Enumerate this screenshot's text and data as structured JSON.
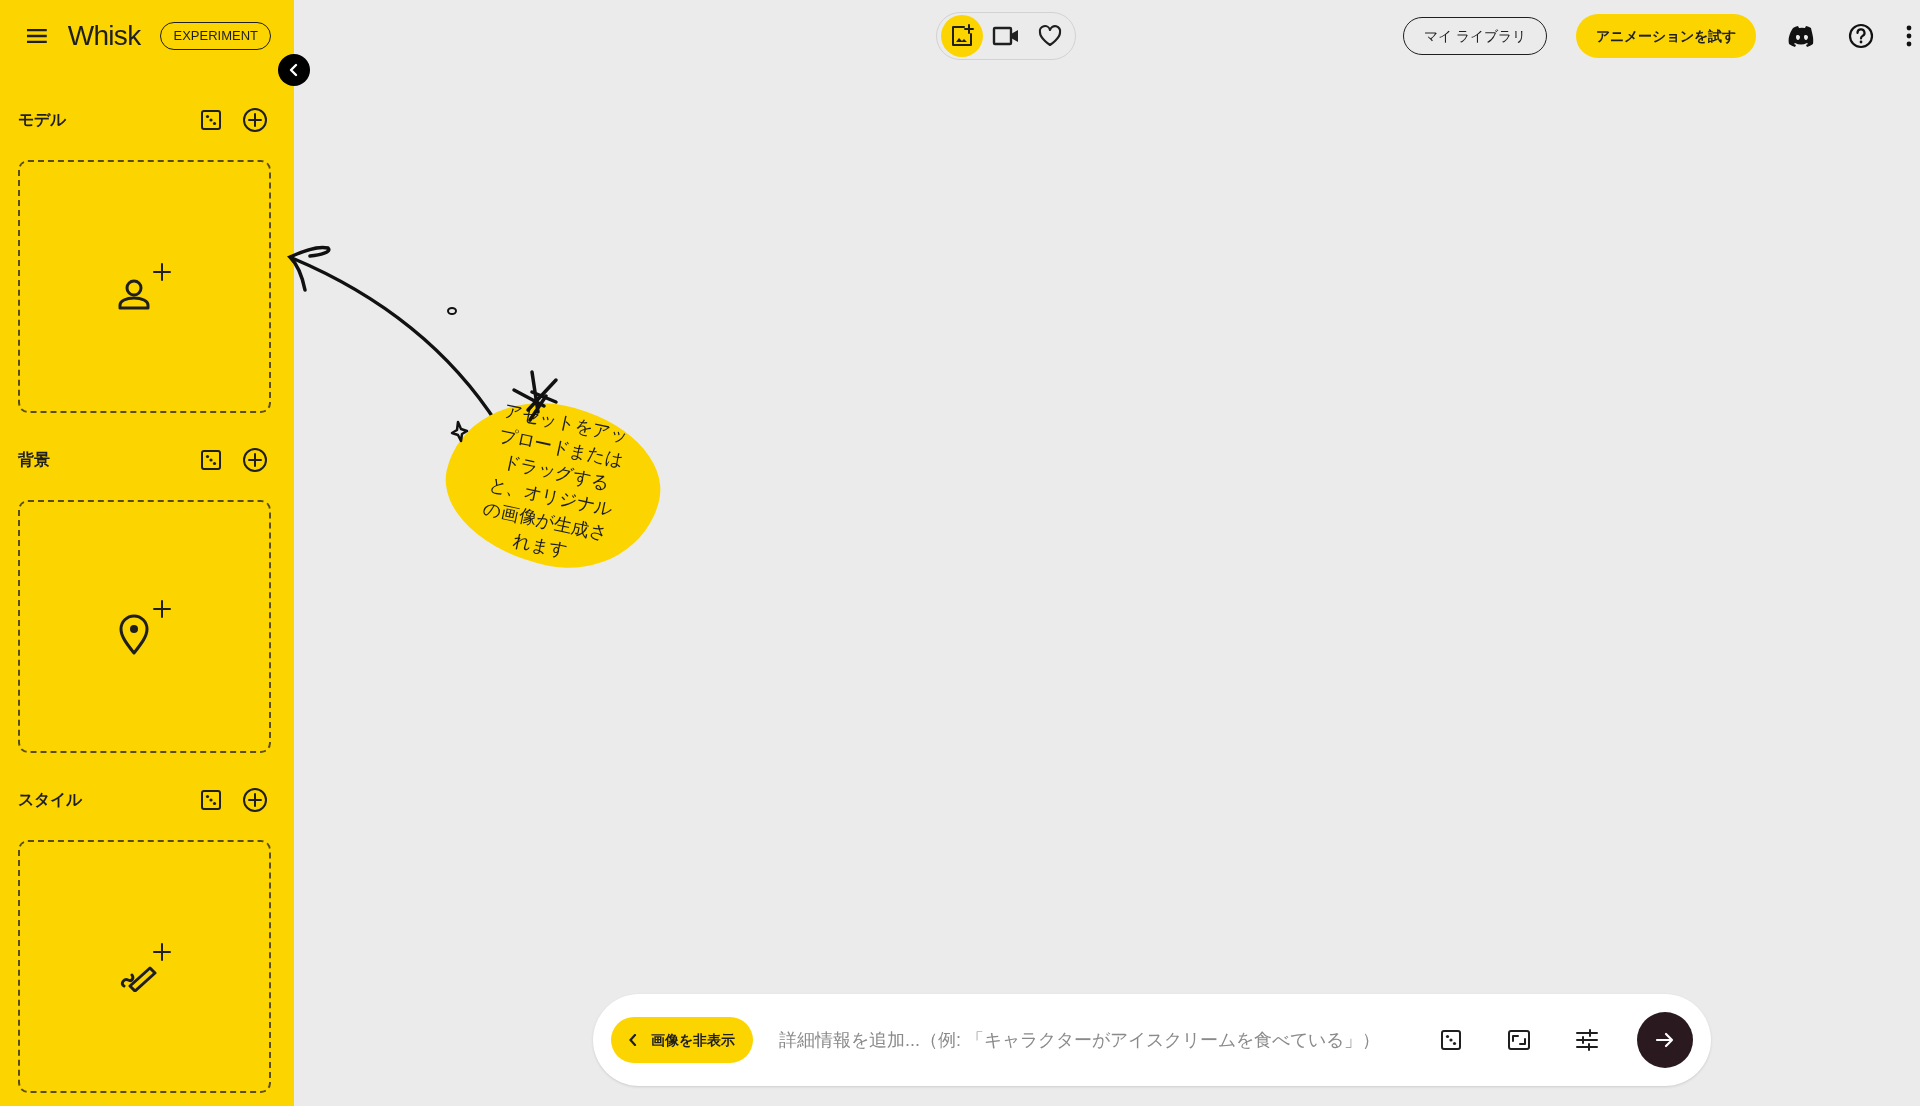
{
  "header": {
    "logo": "Whisk",
    "badge": "EXPERIMENT"
  },
  "sections": [
    {
      "title": "モデル",
      "kind": "subject"
    },
    {
      "title": "背景",
      "kind": "scene"
    },
    {
      "title": "スタイル",
      "kind": "style"
    }
  ],
  "mode_tabs": [
    {
      "kind": "image",
      "selected": true
    },
    {
      "kind": "video",
      "selected": false
    },
    {
      "kind": "favorites",
      "selected": false
    }
  ],
  "top_buttons": {
    "library": "マイ ライブラリ",
    "animate": "アニメーションを試す"
  },
  "hint": {
    "text": "アセットをアップロードまたはドラッグすると、オリジナルの画像が生成されます"
  },
  "prompt_bar": {
    "hide_button": "画像を非表示",
    "placeholder": "詳細情報を追加...（例: 「キャラクターがアイスクリームを食べている」）"
  }
}
